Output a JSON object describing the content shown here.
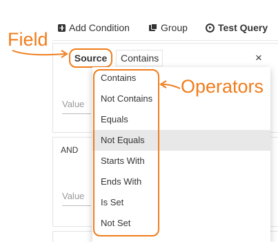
{
  "toolbar": {
    "add_condition": "Add Condition",
    "group": "Group",
    "test_query": "Test Query"
  },
  "condition1": {
    "field": "Source",
    "operator": "Contains",
    "value_placeholder": "Value",
    "remove": "×"
  },
  "conjunction": "AND",
  "condition2": {
    "value_placeholder": "Value"
  },
  "operators": [
    "Contains",
    "Not Contains",
    "Equals",
    "Not Equals",
    "Starts With",
    "Ends With",
    "Is Set",
    "Not Set"
  ],
  "highlighted_operator": "Not Equals",
  "callouts": {
    "field": "Field",
    "operators": "Operators"
  },
  "colors": {
    "accent": "#f07c1a",
    "highlight": "#e8e8e8"
  }
}
